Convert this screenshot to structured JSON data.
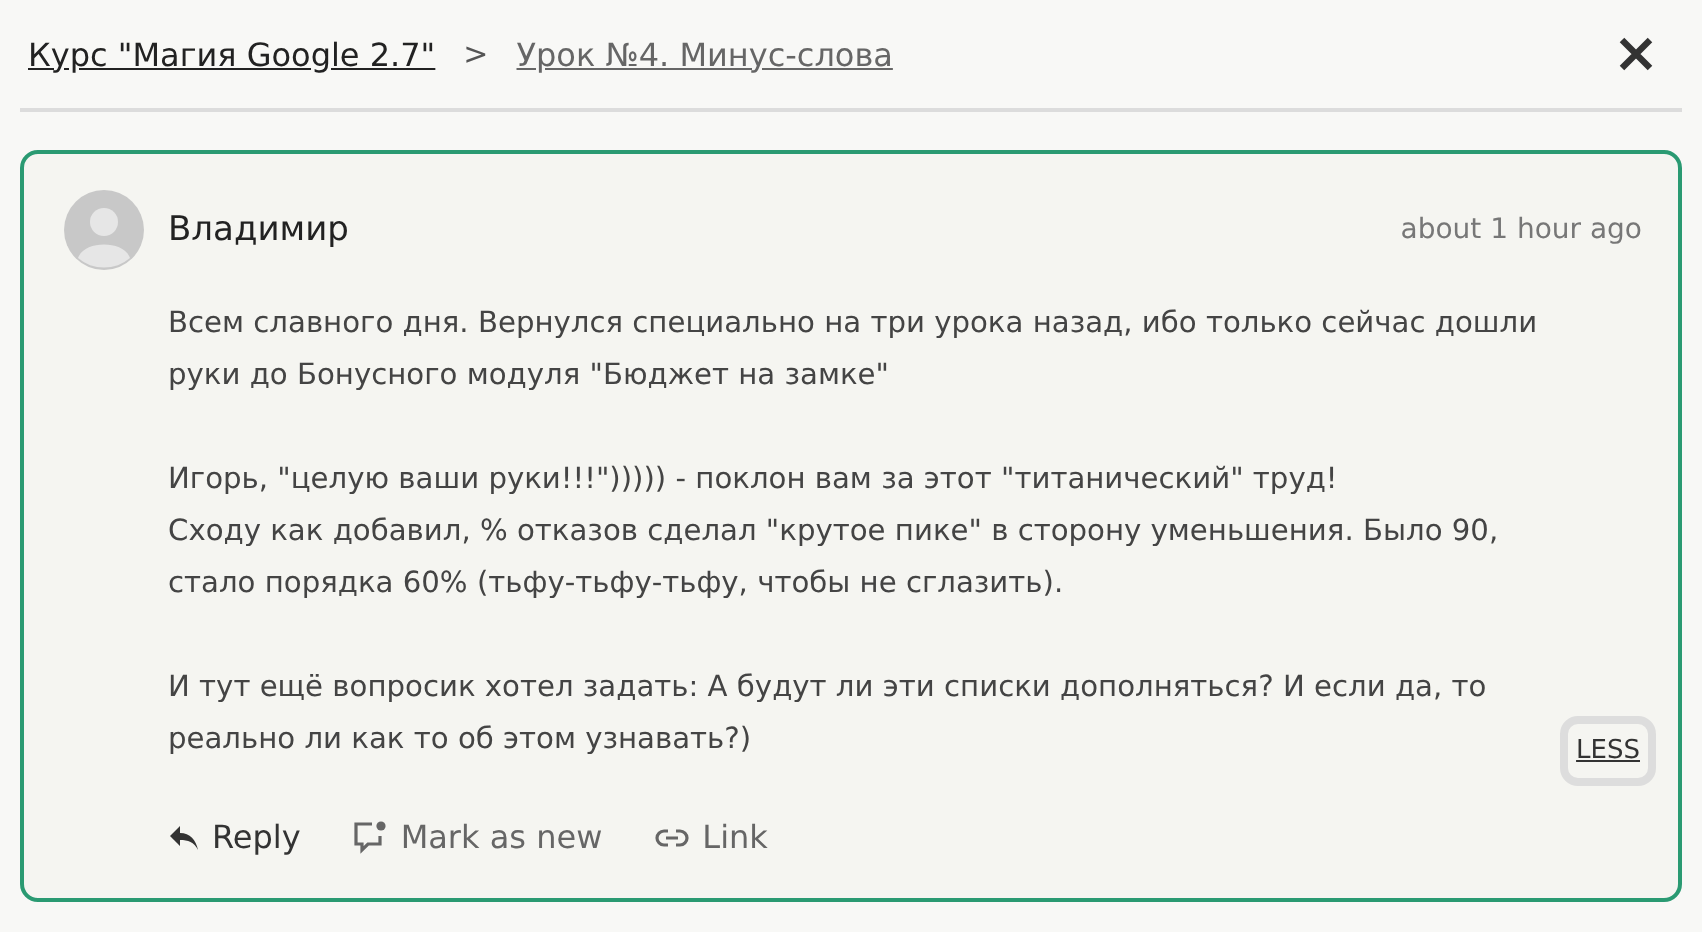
{
  "breadcrumb": [
    {
      "label": "Курс \"Магия Google 2.7\"",
      "current": false
    },
    {
      "label": "Урок №4. Минус-слова",
      "current": true
    }
  ],
  "separator": ">",
  "comment": {
    "author": "Владимир",
    "time": "about 1 hour ago",
    "paragraphs": [
      [
        "Всем славного дня. Вернулся специально на три урока назад, ибо только сейчас дошли",
        "руки до Бонусного модуля \"Бюджет на замке\""
      ],
      [
        "Игорь, \"целую ваши руки!!!\"))))) - поклон вам за этот \"титанический\" труд!",
        "Сходу как добавил, % отказов сделал \"крутое пике\" в сторону уменьшения. Было 90,",
        "стало порядка 60% (тьфу-тьфу-тьфу, чтобы не сглазить)."
      ],
      [
        "И тут ещё вопросик хотел задать: А будут ли эти списки дополняться? И если да, то",
        "реально ли как то об этом узнавать?)"
      ]
    ],
    "toggle": "LESS",
    "actions": [
      {
        "kind": "reply",
        "label": "Reply"
      },
      {
        "kind": "mark",
        "label": "Mark as new"
      },
      {
        "kind": "link",
        "label": "Link"
      }
    ]
  }
}
